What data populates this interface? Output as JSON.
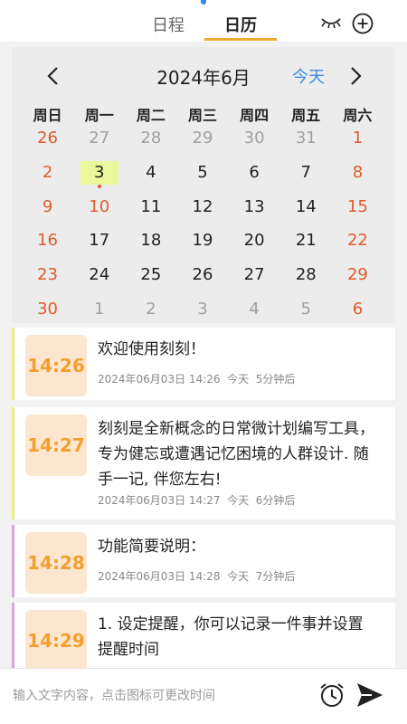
{
  "tabs": [
    {
      "label": "日程"
    },
    {
      "label": "日历"
    }
  ],
  "header_icons": {
    "hide": "closed-eye-icon",
    "add": "plus-circle-icon"
  },
  "calendar": {
    "title": "2024年6月",
    "today_label": "今天",
    "weekdays": [
      "周日",
      "周一",
      "周二",
      "周三",
      "周四",
      "周五",
      "周六"
    ],
    "weeks": [
      [
        "26",
        "27",
        "28",
        "29",
        "30",
        "31",
        "1"
      ],
      [
        "2",
        "3",
        "4",
        "5",
        "6",
        "7",
        "8"
      ],
      [
        "9",
        "10",
        "11",
        "12",
        "13",
        "14",
        "15"
      ],
      [
        "16",
        "17",
        "18",
        "19",
        "20",
        "21",
        "22"
      ],
      [
        "23",
        "24",
        "25",
        "26",
        "27",
        "28",
        "29"
      ],
      [
        "30",
        "1",
        "2",
        "3",
        "4",
        "5",
        "6"
      ]
    ],
    "colors": {
      "weekend": "#e05a2a",
      "accent": "#3b8be6",
      "today_highlight": "#eaf79a"
    }
  },
  "events": [
    {
      "time": "14:26",
      "text": "欢迎使用刻刻！",
      "date": "2024年06月03日 14:26",
      "day": "今天",
      "relative": "5分钟后",
      "bar_color": "#e6f07a"
    },
    {
      "time": "14:27",
      "text": "刻刻是全新概念的日常微计划编写工具，专为健忘或遭遇记忆困境的人群设计. 随手一记, 伴您左右!",
      "date": "2024年06月03日 14:27",
      "day": "今天",
      "relative": "6分钟后",
      "bar_color": "#e6f07a"
    },
    {
      "time": "14:28",
      "text": "功能简要说明：",
      "date": "2024年06月03日 14:28",
      "day": "今天",
      "relative": "7分钟后",
      "bar_color": "#d6a6dc"
    },
    {
      "time": "14:29",
      "text": "1. 设定提醒，你可以记录一件事并设置提醒时间",
      "date": "",
      "day": "",
      "relative": "",
      "bar_color": "#d6a6dc"
    }
  ],
  "composer": {
    "placeholder": "输入文字内容，点击图标可更改时间",
    "alarm_icon": "alarm-clock-icon",
    "send_icon": "send-icon"
  }
}
